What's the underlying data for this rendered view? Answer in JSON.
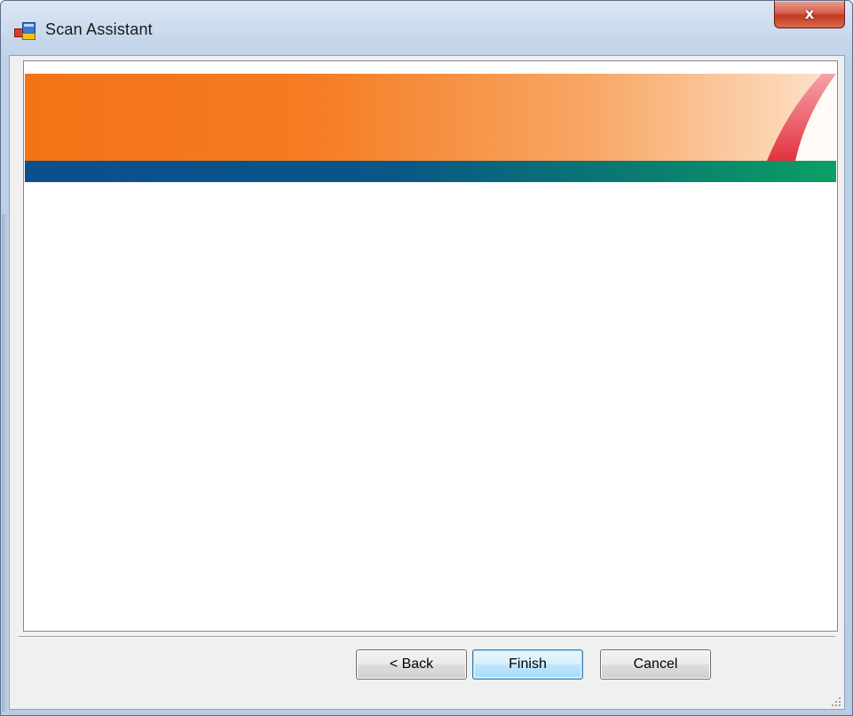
{
  "window": {
    "title": "Scan Assistant",
    "close_label": "x"
  },
  "banner": {
    "colors": {
      "orange_start": "#f47216",
      "orange_end": "#fbd3b0",
      "blue_start": "#0b4f8e",
      "green_end": "#0aa064",
      "swoosh": "#e8404f"
    }
  },
  "buttons": {
    "back_label": "< Back",
    "finish_label": "Finish",
    "cancel_label": "Cancel"
  },
  "icons": {
    "app": "window-app-icon",
    "close": "close-icon",
    "grip": "resize-grip-icon"
  }
}
